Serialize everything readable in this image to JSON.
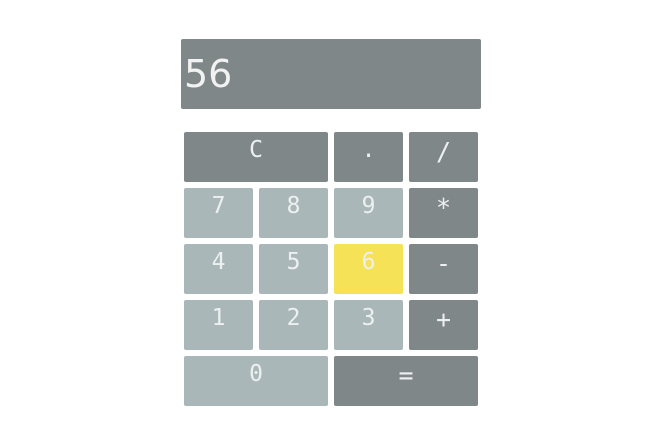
{
  "display": {
    "value": "56"
  },
  "keys": {
    "clear": "C",
    "decimal": ".",
    "divide": "/",
    "seven": "7",
    "eight": "8",
    "nine": "9",
    "multiply": "*",
    "four": "4",
    "five": "5",
    "six": "6",
    "subtract": "-",
    "one": "1",
    "two": "2",
    "three": "3",
    "add": "+",
    "zero": "0",
    "equals": "="
  },
  "colors": {
    "operator_key": "#7f8789",
    "digit_key": "#a9b7b8",
    "highlighted_key": "#f5e256",
    "display_background": "#7f8789",
    "key_text": "#eef0f0"
  },
  "state": {
    "highlighted_key": "six"
  }
}
